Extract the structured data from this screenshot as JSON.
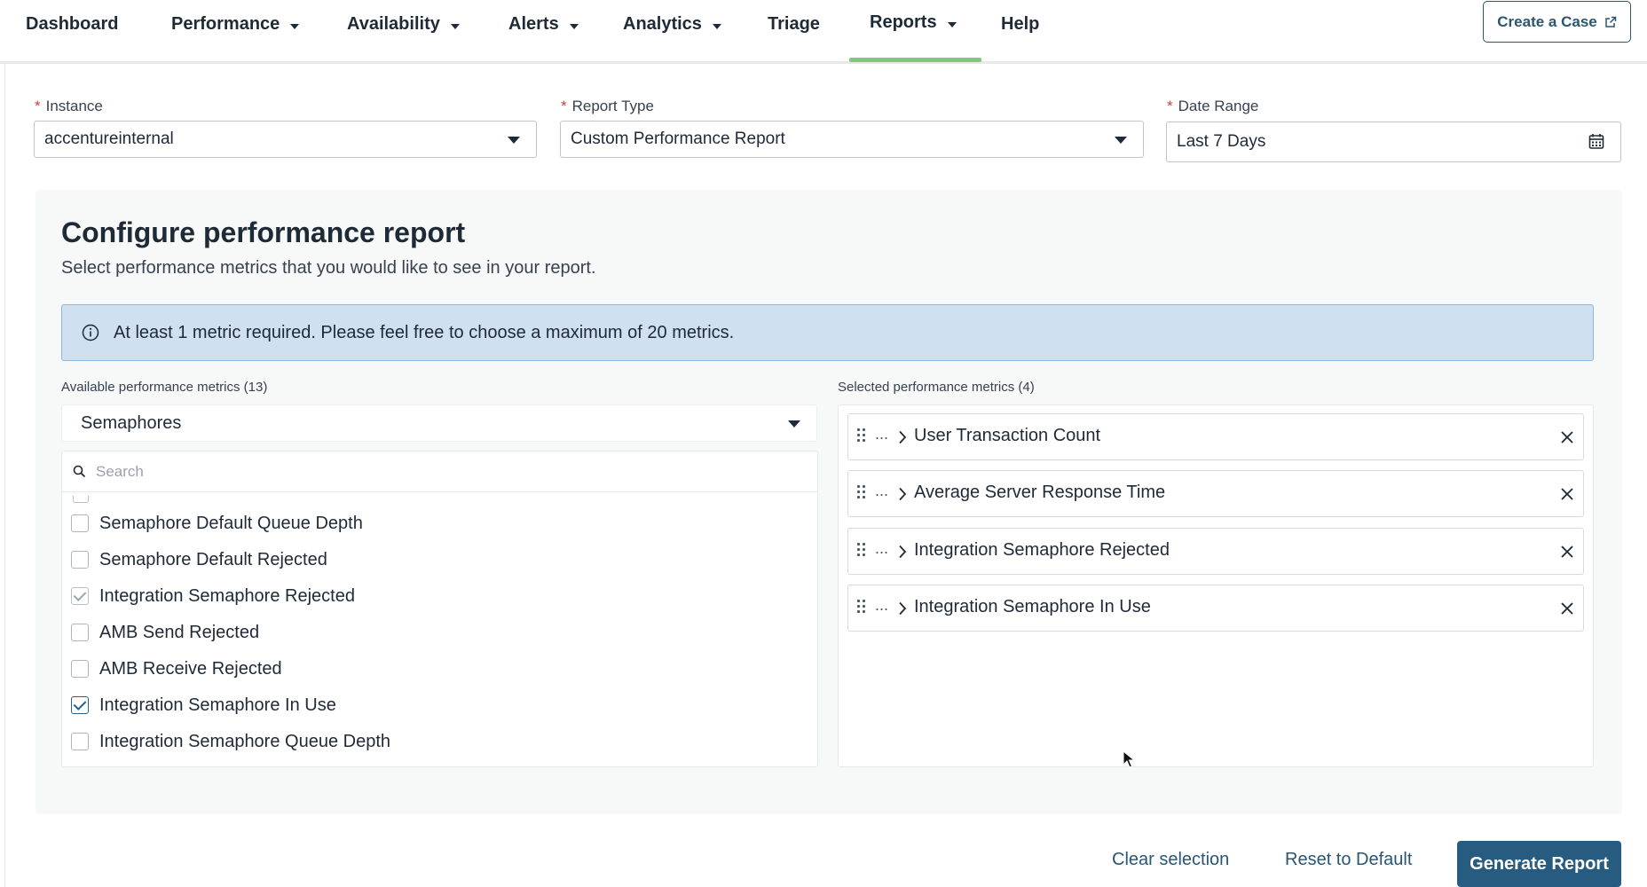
{
  "nav": {
    "items": [
      {
        "label": "Dashboard",
        "dropdown": false
      },
      {
        "label": "Performance",
        "dropdown": true
      },
      {
        "label": "Availability",
        "dropdown": true
      },
      {
        "label": "Alerts",
        "dropdown": true
      },
      {
        "label": "Analytics",
        "dropdown": true
      },
      {
        "label": "Triage",
        "dropdown": false
      },
      {
        "label": "Reports",
        "dropdown": true,
        "active": true
      },
      {
        "label": "Help",
        "dropdown": false
      }
    ],
    "create_case_label": "Create a Case",
    "active_color": "#81c784"
  },
  "filters": {
    "instance": {
      "label": "Instance",
      "value": "accentureinternal"
    },
    "report_type": {
      "label": "Report Type",
      "value": "Custom Performance Report"
    },
    "date_range": {
      "label": "Date Range",
      "value": "Last 7 Days"
    }
  },
  "config": {
    "title": "Configure performance report",
    "subtitle": "Select performance metrics that you would like to see in your report.",
    "info": "At least 1 metric required. Please feel free to choose a maximum of 20 metrics."
  },
  "available": {
    "label": "Available performance metrics (13)",
    "category": "Semaphores",
    "search_placeholder": "Search",
    "items": [
      {
        "label": "Semaphore Default Queue Depth",
        "checked": false
      },
      {
        "label": "Semaphore Default Rejected",
        "checked": false
      },
      {
        "label": "Integration Semaphore Rejected",
        "checked": true
      },
      {
        "label": "AMB Send Rejected",
        "checked": false
      },
      {
        "label": "AMB Receive Rejected",
        "checked": false
      },
      {
        "label": "Integration Semaphore In Use",
        "checked": true
      },
      {
        "label": "Integration Semaphore Queue Depth",
        "checked": false
      }
    ]
  },
  "selected": {
    "label": "Selected performance metrics (4)",
    "ellipsis": "...",
    "items": [
      {
        "label": "User Transaction Count"
      },
      {
        "label": "Average Server Response Time"
      },
      {
        "label": "Integration Semaphore Rejected"
      },
      {
        "label": "Integration Semaphore In Use"
      }
    ]
  },
  "footer": {
    "clear_label": "Clear selection",
    "reset_label": "Reset to Default",
    "generate_label": "Generate Report",
    "primary_color": "#275b7f"
  }
}
